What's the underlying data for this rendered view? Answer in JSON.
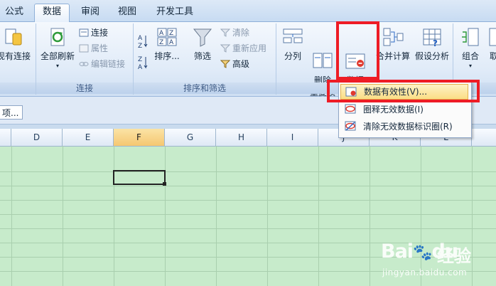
{
  "tabs": [
    {
      "label": "公式",
      "active": false
    },
    {
      "label": "数据",
      "active": true
    },
    {
      "label": "审阅",
      "active": false
    },
    {
      "label": "视图",
      "active": false
    },
    {
      "label": "开发工具",
      "active": false
    }
  ],
  "ribbon": {
    "existing_connections": "现有连接",
    "groups": {
      "connections": "连接",
      "sort_filter": "排序和筛选"
    },
    "refresh_all": "全部刷新",
    "connections": "连接",
    "properties": "属性",
    "edit_links": "编辑链接",
    "sort": "排序...",
    "filter": "筛选",
    "clear": "清除",
    "reapply": "重新应用",
    "advanced": "高级",
    "text_to_columns": "分列",
    "remove_duplicates": "删除\n重复项",
    "data_validation": "数据\n有效性",
    "consolidate": "合并计算",
    "what_if": "假设分析",
    "group": "组合",
    "ungroup": "取"
  },
  "dropdown": {
    "items": [
      {
        "label": "数据有效性(V)..."
      },
      {
        "label": "圈释无效数据(I)"
      },
      {
        "label": "清除无效数据标识圈(R)"
      }
    ]
  },
  "formula_bar": {
    "name_box": "项..."
  },
  "columns": [
    "D",
    "E",
    "F",
    "G",
    "H",
    "I",
    "J",
    "K",
    "L"
  ],
  "selected_column": "F",
  "watermark": {
    "logo": "Bai",
    "logo2": "du",
    "cn": "经验",
    "url": "jingyan.baidu.com"
  }
}
